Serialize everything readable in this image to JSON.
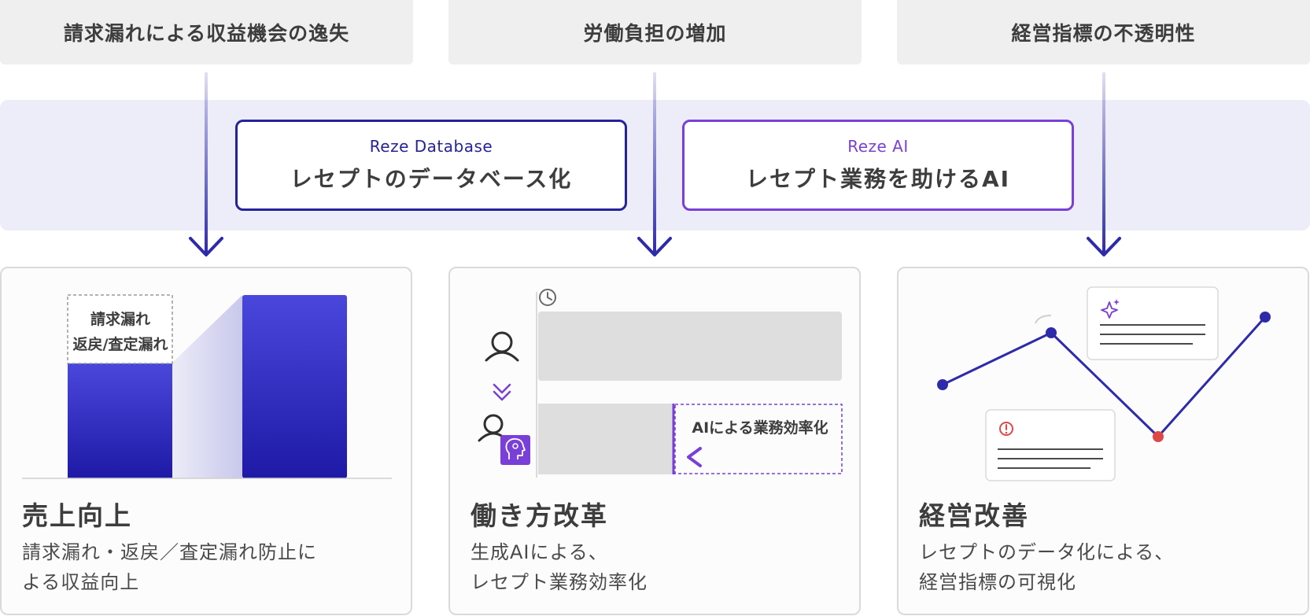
{
  "problems": [
    {
      "label": "請求漏れによる収益機会の逸失"
    },
    {
      "label": "労働負担の増加"
    },
    {
      "label": "経営指標の不透明性"
    }
  ],
  "products": [
    {
      "name": "Reze Database",
      "desc": "レセプトのデータベース化",
      "color": "#26239a"
    },
    {
      "name": "Reze AI",
      "desc": "レセプト業務を助けるAI",
      "color": "#7a3fd6"
    }
  ],
  "results": [
    {
      "title": "売上向上",
      "desc_line1": "請求漏れ・返戻／査定漏れ防止に",
      "desc_line2": "よる収益向上",
      "chart_label_line1": "請求漏れ",
      "chart_label_line2": "返戻/査定漏れ"
    },
    {
      "title": "働き方改革",
      "desc_line1": "生成AIによる、",
      "desc_line2": "レセプト業務効率化",
      "efficiency_label": "AIによる業務効率化"
    },
    {
      "title": "経営改善",
      "desc_line1": "レセプトのデータ化による、",
      "desc_line2": "経営指標の可視化"
    }
  ],
  "colors": {
    "primary": "#2e2baa",
    "accent_purple": "#7a3fd6",
    "alert_red": "#e04848",
    "band": "#ededf9",
    "problem_bg": "#efefef"
  }
}
